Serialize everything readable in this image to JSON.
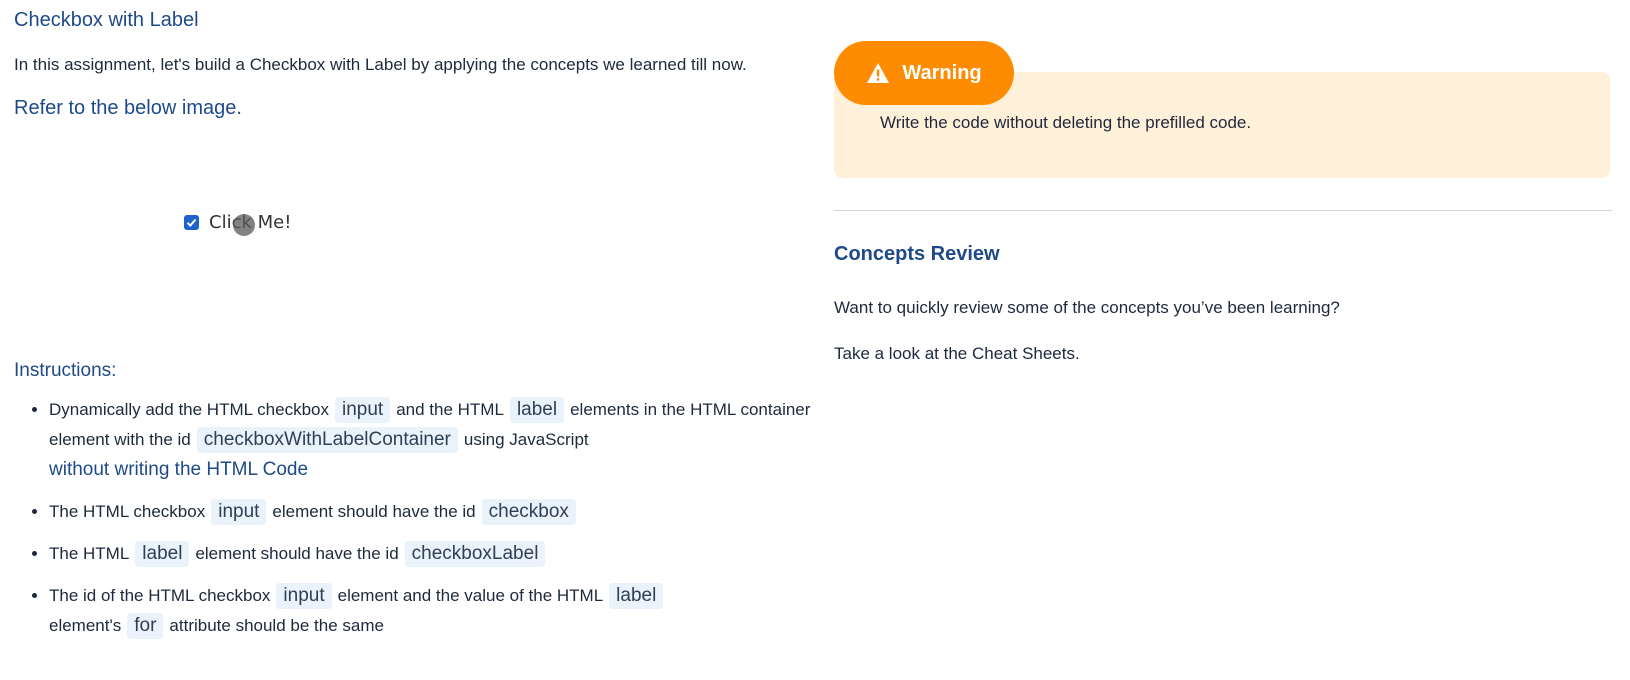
{
  "left": {
    "title": "Checkbox with Label",
    "intro": "In this assignment, let's build a Checkbox with Label by applying the concepts we learned till now.",
    "subhead": "Refer to the below image.",
    "preview_label": "Click Me!",
    "instructions_heading": "Instructions:",
    "bullets": {
      "b1": {
        "t1": "Dynamically add the HTML checkbox",
        "c1": "input",
        "t2": "and the HTML",
        "c2": "label",
        "t3": "elements in the HTML container element with the id",
        "c3": "checkboxWithLabelContainer",
        "t4": "using JavaScript",
        "emph": "without writing the HTML Code"
      },
      "b2": {
        "t1": "The HTML checkbox",
        "c1": "input",
        "t2": "element should have the id",
        "c2": "checkbox"
      },
      "b3": {
        "t1": "The HTML",
        "c1": "label",
        "t2": "element should have the id",
        "c2": "checkboxLabel"
      },
      "b4": {
        "t1": "The id of the HTML checkbox",
        "c1": "input",
        "t2": "element and the value of the HTML",
        "c2": "label",
        "t3": "element's",
        "c3": "for",
        "t4": "attribute should be the same"
      }
    }
  },
  "right": {
    "warning_title": "Warning",
    "warning_text": "Write the code without deleting the prefilled code.",
    "concepts_heading": "Concepts Review",
    "concepts_p1": "Want to quickly review some of the concepts you’ve been learning?",
    "concepts_p2": "Take a look at the Cheat Sheets."
  },
  "colors": {
    "heading": "#1e4a8a",
    "warning_orange": "#ff8c00",
    "warning_bg": "#fff0d9",
    "code_bg": "#eaf3fc",
    "checkbox_blue": "#1d63c9"
  },
  "icons": [
    "checkbox-checked-icon",
    "cursor-indicator-icon",
    "warning-triangle-icon"
  ]
}
